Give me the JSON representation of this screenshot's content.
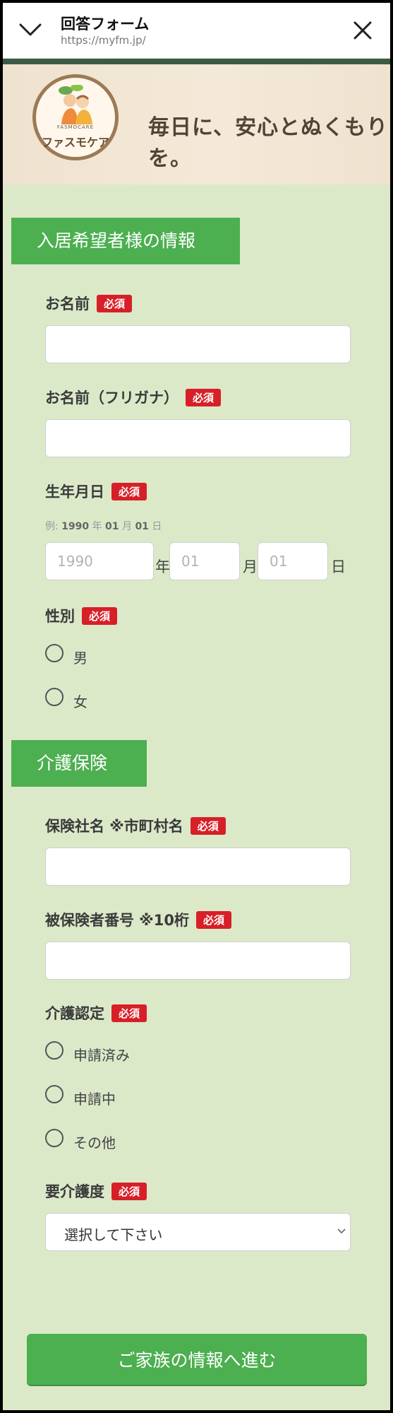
{
  "topbar": {
    "title": "回答フォーム",
    "url": "https://myfm.jp/"
  },
  "banner": {
    "logo_small": "FASMOCARE",
    "logo_name": "ファスモケア",
    "slogan": "毎日に、安心とぬくもりを。"
  },
  "section1": {
    "title": "入居希望者様の情報",
    "name_label": "お名前",
    "kana_label": "お名前（フリガナ）",
    "birth_label": "生年月日",
    "birth_example": {
      "prefix": "例: ",
      "year": "1990",
      "year_unit": " 年 ",
      "month": "01",
      "month_unit": " 月 ",
      "day": "01",
      "day_unit": " 日"
    },
    "year_placeholder": "1990",
    "month_placeholder": "01",
    "day_placeholder": "01",
    "year_unit": "年",
    "month_unit": "月",
    "day_unit": "日",
    "gender_label": "性別",
    "gender_options": [
      "男",
      "女"
    ]
  },
  "section2": {
    "title": "介護保険",
    "insurer_label": "保険社名 ※市町村名",
    "insured_number_label": "被保険者番号 ※10桁",
    "certification_label": "介護認定",
    "certification_options": [
      "申請済み",
      "申請中",
      "その他"
    ],
    "care_level_label": "要介護度",
    "care_level_selected": "選択して下さい"
  },
  "required_badge": "必須",
  "submit_label": "ご家族の情報へ進む",
  "colors": {
    "background": "#dbe9c9",
    "section_green": "#4caf50",
    "required_red": "#d71f28"
  },
  "icons": [
    "chevron-down-icon",
    "close-icon",
    "select-caret-icon"
  ]
}
